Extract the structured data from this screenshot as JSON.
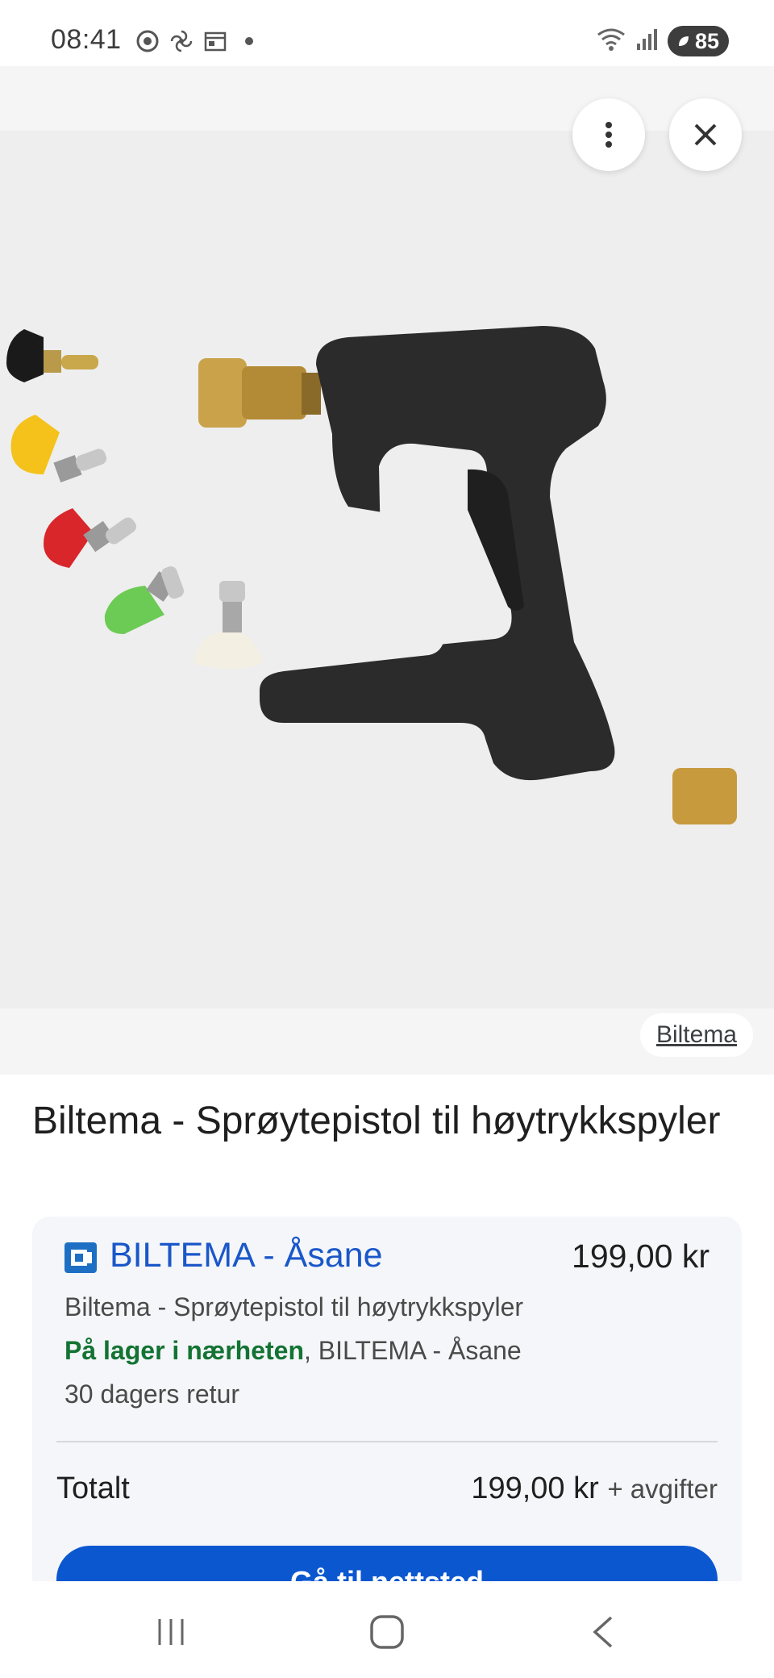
{
  "status_bar": {
    "time": "08:41",
    "battery": "85",
    "icons": [
      "chrome-icon",
      "fan-icon",
      "calendar-icon",
      "dot-icon",
      "wifi-icon",
      "signal-icon",
      "battery-icon"
    ]
  },
  "image_viewer": {
    "source": "Biltema"
  },
  "product": {
    "title": "Biltema - Sprøytepistol til høytrykkspyler"
  },
  "offer": {
    "store": "BILTEMA - Åsane",
    "price": "199,00 kr",
    "description": "Biltema - Sprøytepistol til høytrykkspyler",
    "stock_label": "På lager i nærheten",
    "stock_location": ", BILTEMA - Åsane",
    "returns": "30 dagers retur",
    "total_label": "Totalt",
    "total_price": "199,00 kr",
    "fees": "+ avgifter",
    "button_label": "Gå til nettsted"
  },
  "colors": {
    "link_blue": "#1a57c9",
    "stock_green": "#137333",
    "button_blue": "#0b57d0"
  }
}
